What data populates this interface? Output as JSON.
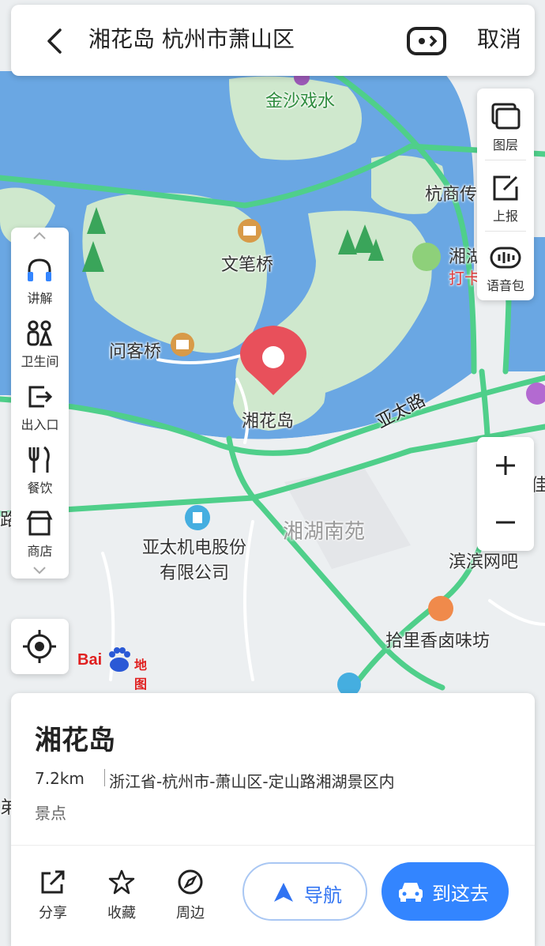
{
  "search": {
    "query": "湘花岛 杭州市萧山区",
    "cancel_label": "取消"
  },
  "right_tools": [
    {
      "name": "layers",
      "label": "图层"
    },
    {
      "name": "report",
      "label": "上报"
    },
    {
      "name": "voice-pack",
      "label": "语音包"
    }
  ],
  "left_tools": [
    {
      "name": "guide",
      "label": "讲解"
    },
    {
      "name": "restroom",
      "label": "卫生间"
    },
    {
      "name": "entrance-exit",
      "label": "出入口"
    },
    {
      "name": "dining",
      "label": "餐饮"
    },
    {
      "name": "shop",
      "label": "商店"
    }
  ],
  "zoom": {
    "in": "+",
    "out": "−"
  },
  "logo": {
    "brand": "Bai",
    "product": "地图"
  },
  "map_labels": {
    "jinsha": "金沙戏水",
    "hangshang": "杭商传",
    "wenbi": "文笔桥",
    "xianghu_partial": "湘湖",
    "daka_partial": "打卡",
    "wenke": "问客桥",
    "xianghuadao": "湘花岛",
    "yatai_road": "亚太路",
    "nanyuan": "湘湖南苑",
    "yatai_company": "亚太机电股份\n有限公司",
    "binbin": "滨滨网吧",
    "shili": "拾里香卤味坊",
    "left_road_partial": "路",
    "right_partial": "佳",
    "left_edge_partial": "弟"
  },
  "place": {
    "name": "湘花岛",
    "distance": "7.2km",
    "address": "浙江省-杭州市-萧山区-定山路湘湖景区内",
    "category": "景点"
  },
  "actions": [
    {
      "name": "share",
      "label": "分享"
    },
    {
      "name": "favorite",
      "label": "收藏"
    },
    {
      "name": "nearby",
      "label": "周边"
    }
  ],
  "nav_label": "导航",
  "go_label": "到这去",
  "colors": {
    "accent": "#3385ff",
    "water": "#6aa7e3",
    "park": "#cfe8cd",
    "road": "#4fcf8a",
    "pin": "#e8505b"
  }
}
